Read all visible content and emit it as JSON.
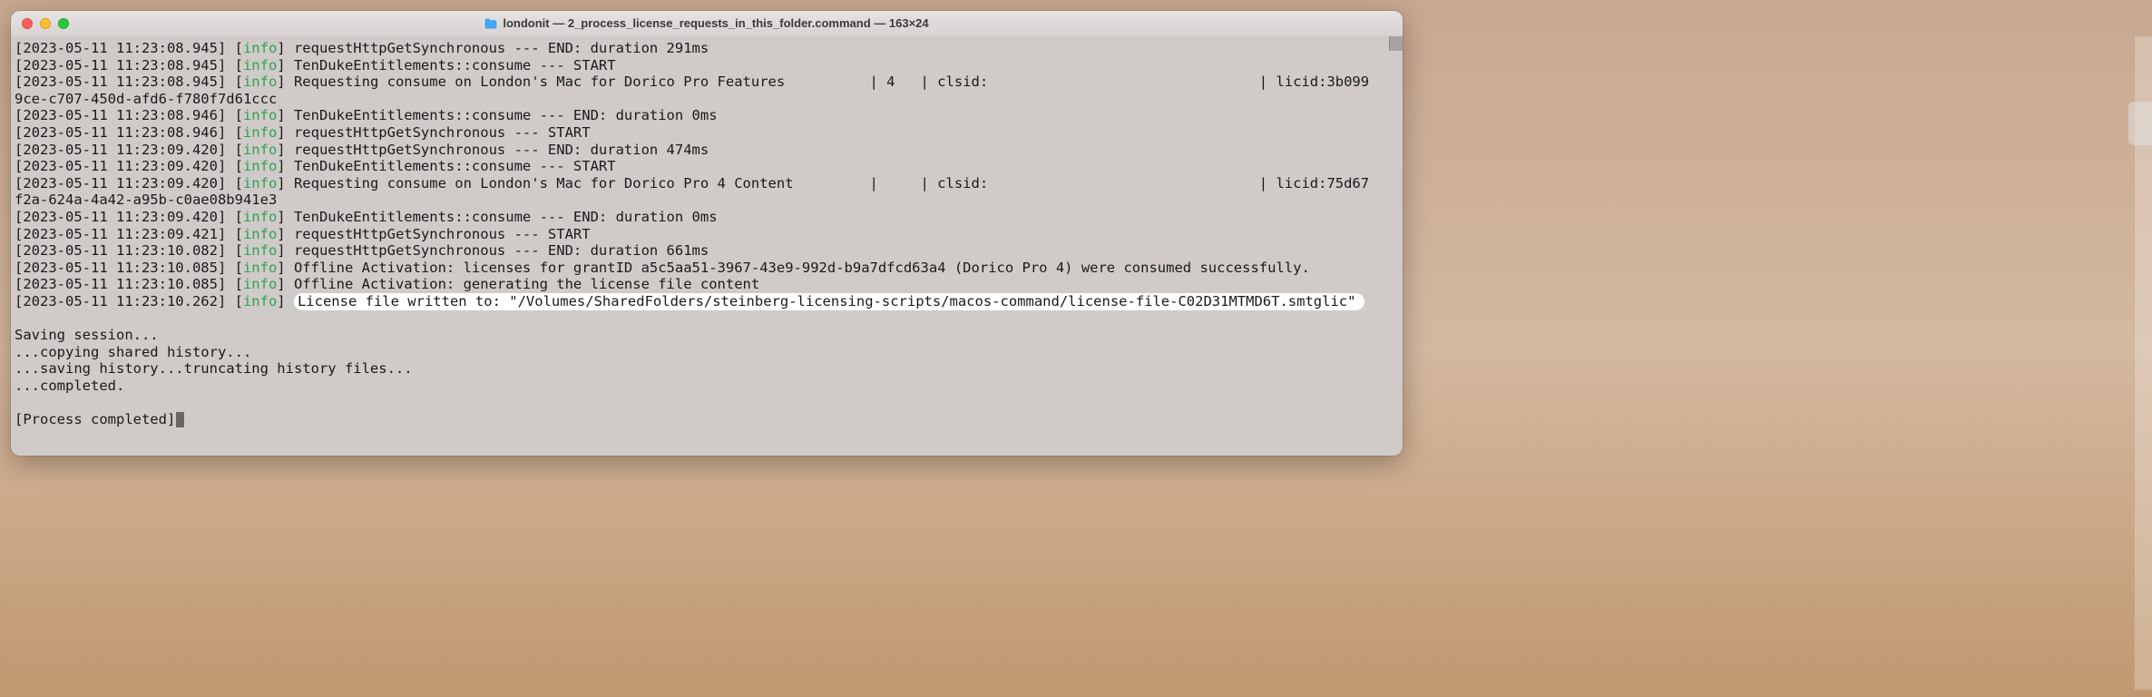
{
  "window": {
    "title": "londonit — 2_process_license_requests_in_this_folder.command — 163×24"
  },
  "log": {
    "info_label": "info",
    "lines": [
      {
        "ts": "[2023-05-11 11:23:08.945]",
        "msg": "requestHttpGetSynchronous --- END: duration 291ms"
      },
      {
        "ts": "[2023-05-11 11:23:08.945]",
        "msg": "TenDukeEntitlements::consume --- START"
      },
      {
        "ts": "[2023-05-11 11:23:08.945]",
        "msg": "Requesting consume on London's Mac for Dorico Pro Features          | 4   | clsid:                                | licid:3b099"
      },
      {
        "cont": "9ce-c707-450d-afd6-f780f7d61ccc"
      },
      {
        "ts": "[2023-05-11 11:23:08.946]",
        "msg": "TenDukeEntitlements::consume --- END: duration 0ms"
      },
      {
        "ts": "[2023-05-11 11:23:08.946]",
        "msg": "requestHttpGetSynchronous --- START"
      },
      {
        "ts": "[2023-05-11 11:23:09.420]",
        "msg": "requestHttpGetSynchronous --- END: duration 474ms"
      },
      {
        "ts": "[2023-05-11 11:23:09.420]",
        "msg": "TenDukeEntitlements::consume --- START"
      },
      {
        "ts": "[2023-05-11 11:23:09.420]",
        "msg": "Requesting consume on London's Mac for Dorico Pro 4 Content         |     | clsid:                                | licid:75d67"
      },
      {
        "cont": "f2a-624a-4a42-a95b-c0ae08b941e3"
      },
      {
        "ts": "[2023-05-11 11:23:09.420]",
        "msg": "TenDukeEntitlements::consume --- END: duration 0ms"
      },
      {
        "ts": "[2023-05-11 11:23:09.421]",
        "msg": "requestHttpGetSynchronous --- START"
      },
      {
        "ts": "[2023-05-11 11:23:10.082]",
        "msg": "requestHttpGetSynchronous --- END: duration 661ms"
      },
      {
        "ts": "[2023-05-11 11:23:10.085]",
        "msg": "Offline Activation: licenses for grantID a5c5aa51-3967-43e9-992d-b9a7dfcd63a4 (Dorico Pro 4) were consumed successfully."
      },
      {
        "ts": "[2023-05-11 11:23:10.085]",
        "msg": "Offline Activation: generating the license file content"
      },
      {
        "ts": "[2023-05-11 11:23:10.262]",
        "msg_highlighted": "License file written to: \"/Volumes/SharedFolders/steinberg-licensing-scripts/macos-command/license-file-C02D31MTMD6T.smtglic\""
      }
    ],
    "tail": [
      "",
      "Saving session...",
      "...copying shared history...",
      "...saving history...truncating history files...",
      "...completed.",
      "",
      "[Process completed]"
    ]
  }
}
